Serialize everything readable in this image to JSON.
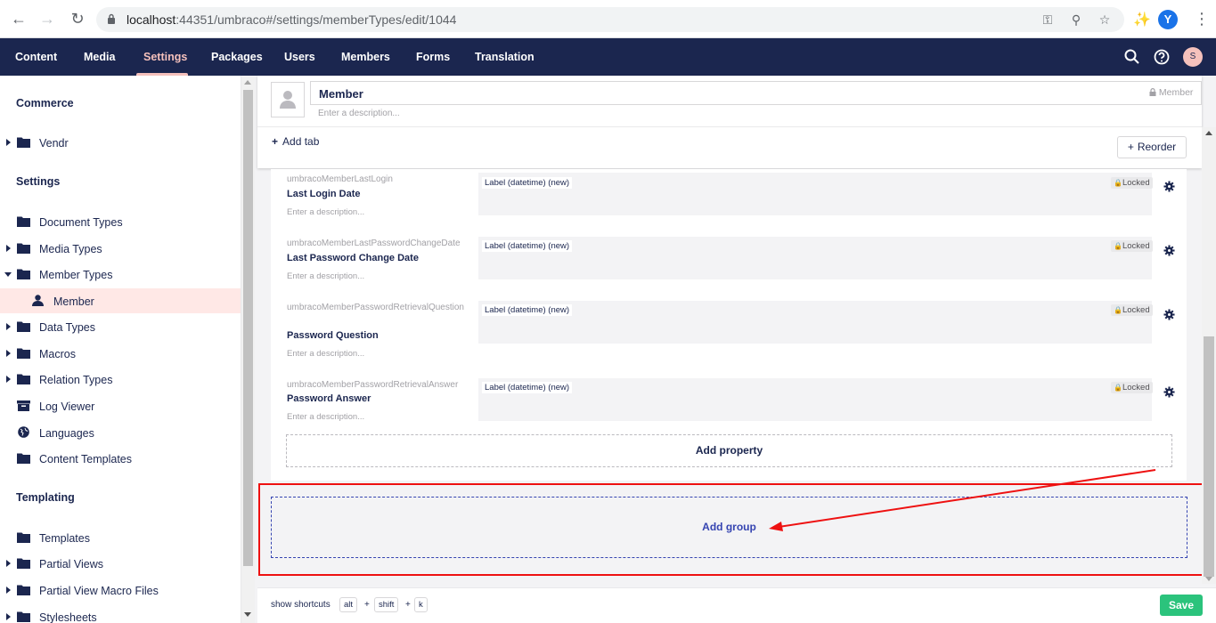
{
  "browser": {
    "url_host": "localhost",
    "url_path": ":44351/umbraco#/settings/memberTypes/edit/1044",
    "profile_initial": "Y"
  },
  "header": {
    "sections": [
      "Content",
      "Media",
      "Settings",
      "Packages",
      "Users",
      "Members",
      "Forms",
      "Translation"
    ],
    "active_section": "Settings",
    "user_initial": "S"
  },
  "tree": {
    "headings": [
      "Commerce",
      "Settings",
      "Templating"
    ],
    "items": [
      {
        "label": "Vendr",
        "icon": "folder-icon",
        "expandable": true
      },
      {
        "label": "Document Types",
        "icon": "folder-icon",
        "expandable": false
      },
      {
        "label": "Media Types",
        "icon": "folder-icon",
        "expandable": true
      },
      {
        "label": "Member Types",
        "icon": "folder-icon",
        "expandable": true,
        "open": true
      },
      {
        "label": "Member",
        "icon": "user-icon",
        "selected": true
      },
      {
        "label": "Data Types",
        "icon": "folder-icon",
        "expandable": true
      },
      {
        "label": "Macros",
        "icon": "folder-icon",
        "expandable": true
      },
      {
        "label": "Relation Types",
        "icon": "folder-icon",
        "expandable": true
      },
      {
        "label": "Log Viewer",
        "icon": "box-icon",
        "expandable": false
      },
      {
        "label": "Languages",
        "icon": "globe-icon",
        "expandable": false
      },
      {
        "label": "Content Templates",
        "icon": "folder-icon",
        "expandable": false
      },
      {
        "label": "Templates",
        "icon": "folder-icon",
        "expandable": false
      },
      {
        "label": "Partial Views",
        "icon": "folder-icon",
        "expandable": true
      },
      {
        "label": "Partial View Macro Files",
        "icon": "folder-icon",
        "expandable": true
      },
      {
        "label": "Stylesheets",
        "icon": "folder-icon",
        "expandable": true
      }
    ]
  },
  "editor": {
    "name": "Member",
    "alias": "Member",
    "description_placeholder": "Enter a description...",
    "add_tab": "Add tab",
    "reorder": "Reorder",
    "properties": [
      {
        "alias": "umbracoMemberLastLogin",
        "label": "Last Login Date",
        "description": "Enter a description...",
        "editor": "Label (datetime) (new)",
        "locked": "Locked"
      },
      {
        "alias": "umbracoMemberLastPasswordChangeDate",
        "label": "Last Password Change Date",
        "description": "Enter a description...",
        "editor": "Label (datetime) (new)",
        "locked": "Locked"
      },
      {
        "alias": "umbracoMemberPasswordRetrievalQuestion",
        "label": "Password Question",
        "description": "Enter a description...",
        "editor": "Label (datetime) (new)",
        "locked": "Locked"
      },
      {
        "alias": "umbracoMemberPasswordRetrievalAnswer",
        "label": "Password Answer",
        "description": "Enter a description...",
        "editor": "Label (datetime) (new)",
        "locked": "Locked"
      }
    ],
    "add_property": "Add property",
    "add_group": "Add group"
  },
  "footer": {
    "shortcuts_label": "show shortcuts",
    "keys": [
      "alt",
      "shift",
      "k"
    ],
    "plus": "+",
    "save": "Save"
  },
  "colors": {
    "header_bg": "#1b264f",
    "active_section": "#f5c1bc",
    "highlight": "#ee1111",
    "save": "#2bc37c"
  }
}
